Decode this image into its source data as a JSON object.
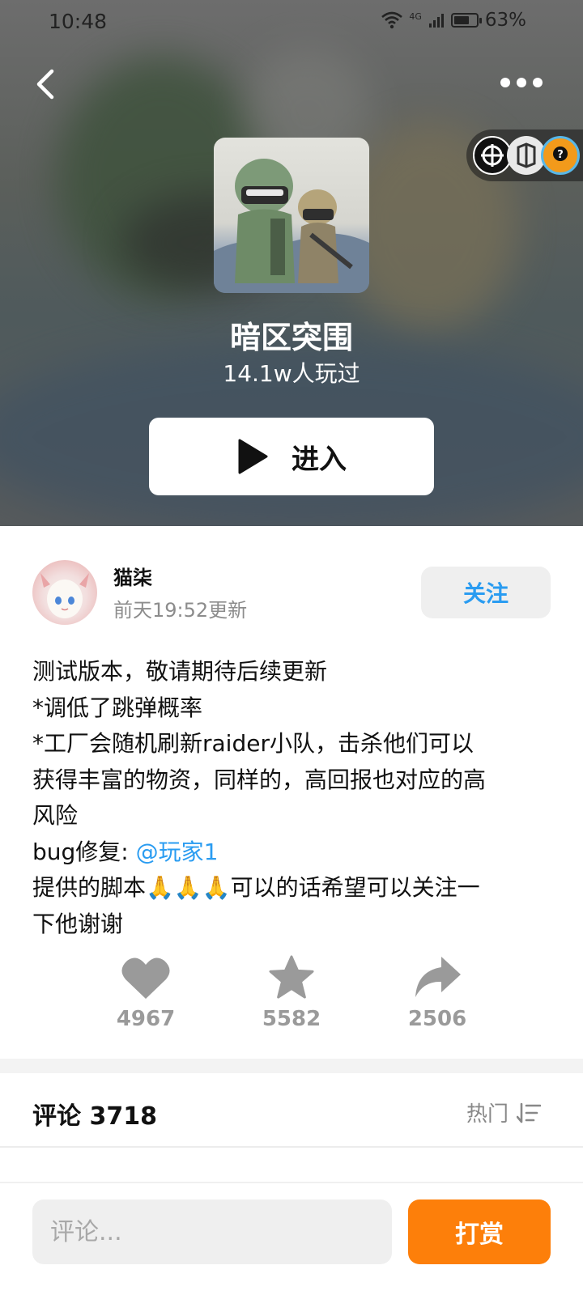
{
  "status_bar": {
    "time": "10:48",
    "network": "4G",
    "battery_percent": "63%"
  },
  "game": {
    "title": "暗区突围",
    "players": "14.1w人玩过",
    "enter_label": "进入"
  },
  "author": {
    "name": "猫柒",
    "updated": "前天19:52更新",
    "follow_label": "关注"
  },
  "description": {
    "line1": "测试版本，敬请期待后续更新",
    "line2": "*调低了跳弹概率",
    "line3": "*工厂会随机刷新raider小队，击杀他们可以",
    "line4": "获得丰富的物资，同样的，高回报也对应的高",
    "line5": "风险",
    "line6_prefix": "bug修复: ",
    "mention": "@玩家1",
    "line7_prefix": "提供的脚本",
    "line7_emoji": "🙏🙏🙏",
    "line7_suffix": "可以的话希望可以关注一",
    "line8": "下他谢谢"
  },
  "actions": {
    "likes": "4967",
    "favorites": "5582",
    "shares": "2506"
  },
  "comments": {
    "title": "评论 3718",
    "sort_label": "热门"
  },
  "bottom": {
    "comment_placeholder": "评论...",
    "tip_label": "打赏"
  },
  "colors": {
    "accent_blue": "#2a9cf1",
    "tip_orange": "#fd7f0a",
    "icon_gray": "#9a9a9a"
  }
}
